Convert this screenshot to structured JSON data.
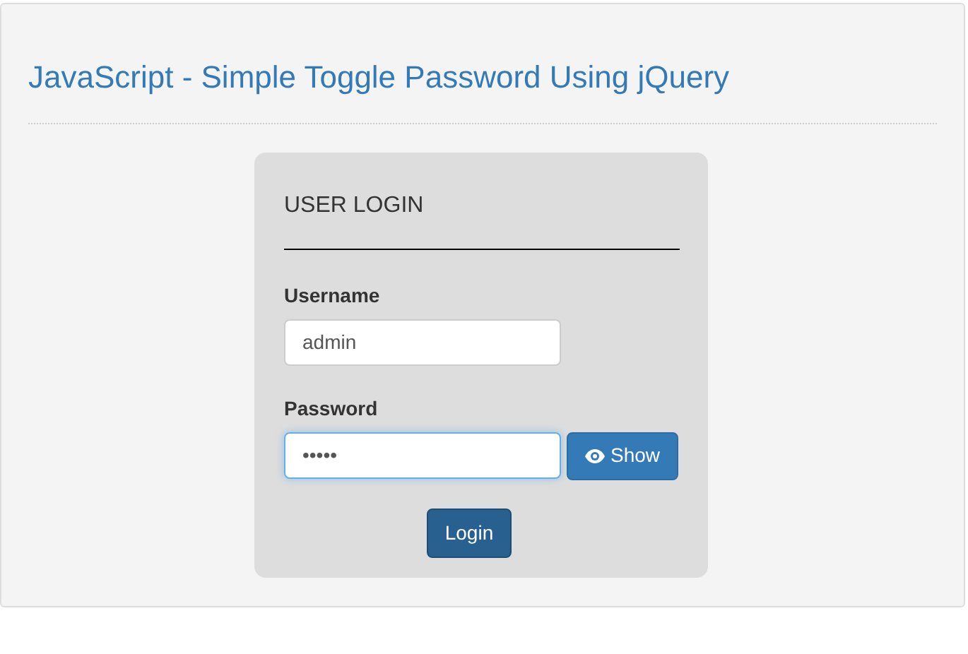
{
  "page": {
    "title": "JavaScript - Simple Toggle Password Using jQuery"
  },
  "login": {
    "heading": "USER LOGIN",
    "username": {
      "label": "Username",
      "value": "admin"
    },
    "password": {
      "label": "Password",
      "value": "•••••",
      "focused": true
    },
    "toggle_button": "Show",
    "submit_button": "Login"
  }
}
